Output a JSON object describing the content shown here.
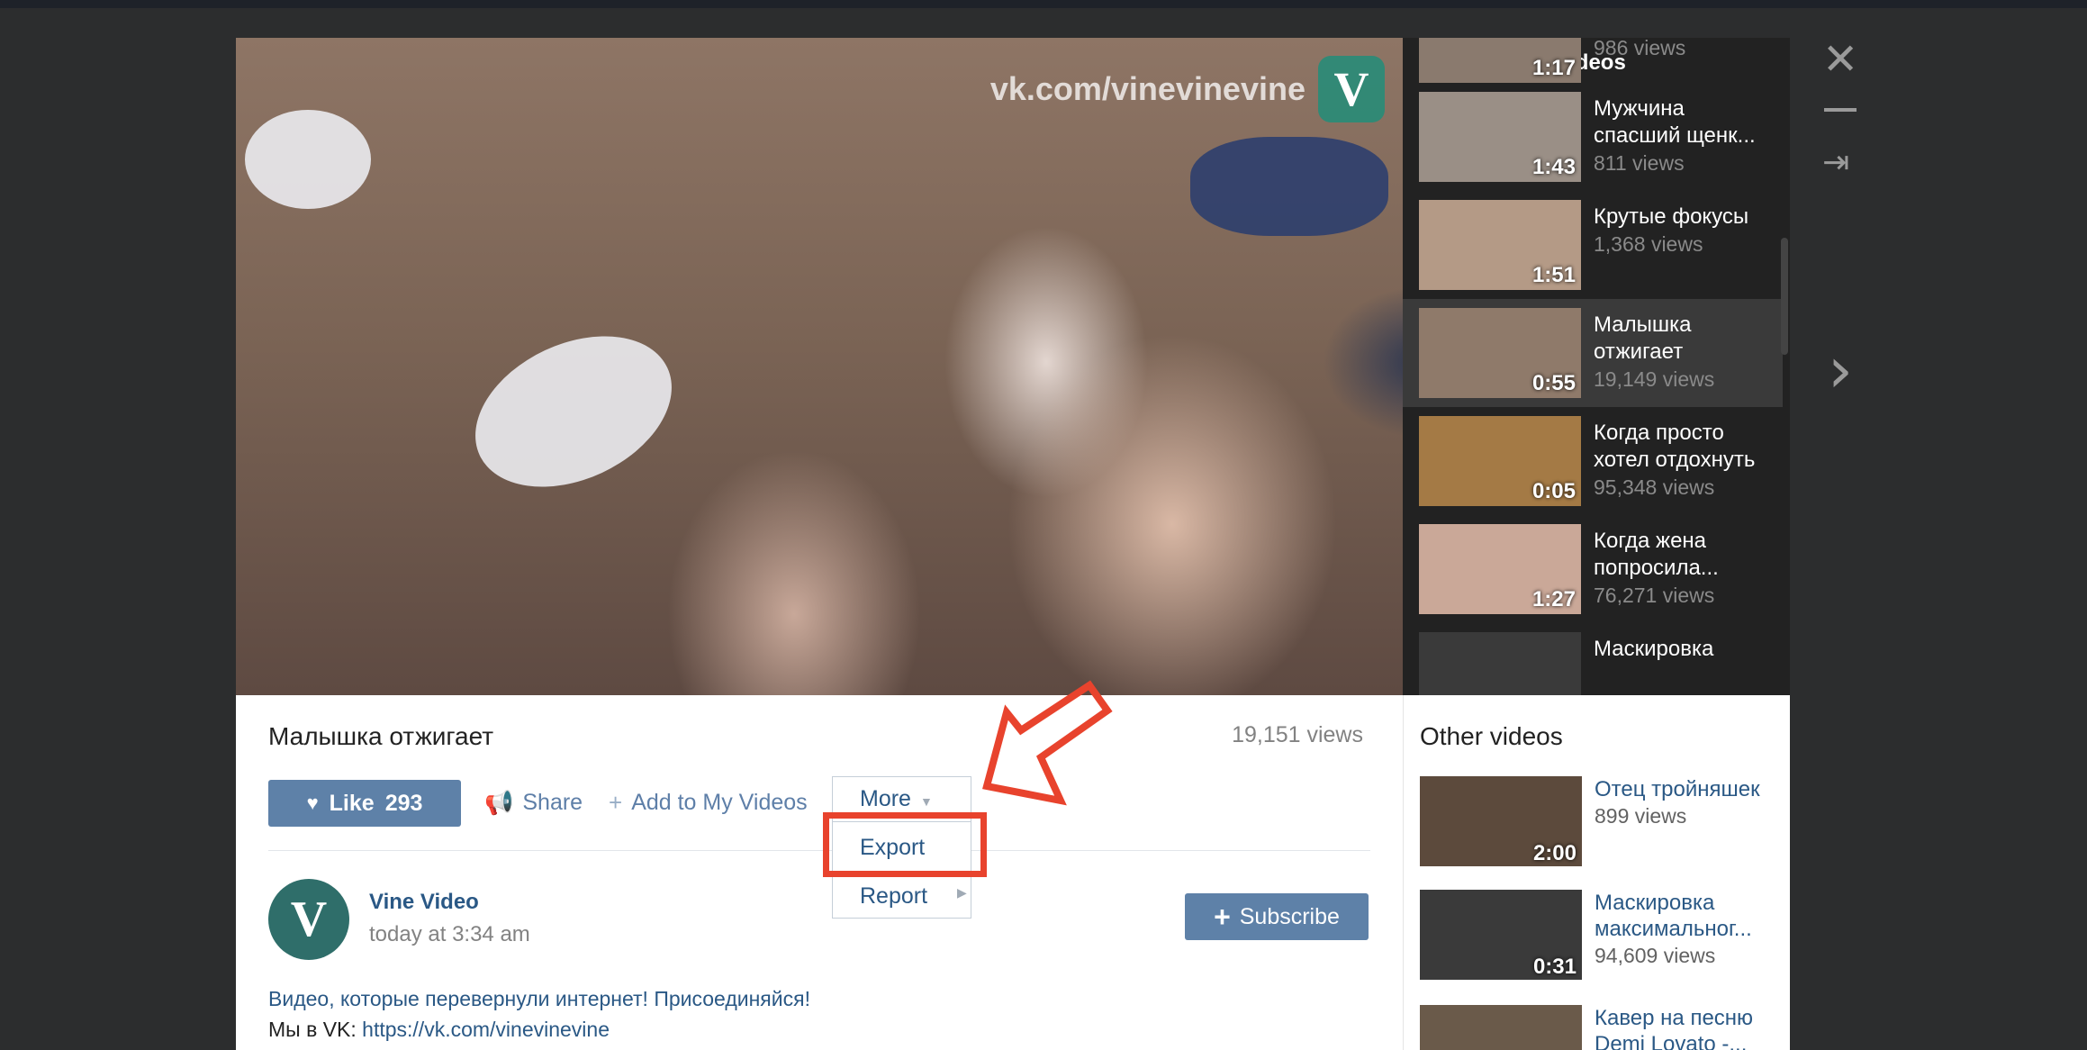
{
  "player": {
    "watermark": "vk.com/vinevinevine",
    "logo_letter": "V"
  },
  "playlist": {
    "title": "Vine Video's Videos",
    "items": [
      {
        "name": "",
        "views": "986 views",
        "duration": "1:17",
        "thumb_color": "#8a7a6e"
      },
      {
        "name": "Мужчина спасший щенк...",
        "views": "811 views",
        "duration": "1:43",
        "thumb_color": "#9a8f86"
      },
      {
        "name": "Крутые фокусы",
        "views": "1,368 views",
        "duration": "1:51",
        "thumb_color": "#b49a86"
      },
      {
        "name": "Малышка отжигает",
        "views": "19,149 views",
        "duration": "0:55",
        "thumb_color": "#8f7a6a",
        "active": true
      },
      {
        "name": "Когда просто хотел отдохнуть",
        "views": "95,348 views",
        "duration": "0:05",
        "thumb_color": "#a47a45"
      },
      {
        "name": "Когда жена попросила...",
        "views": "76,271 views",
        "duration": "1:27",
        "thumb_color": "#caa898"
      },
      {
        "name": "Маскировка",
        "views": "",
        "duration": "",
        "thumb_color": "#3a3a3a"
      }
    ]
  },
  "video": {
    "title": "Малышка отжигает",
    "views": "19,151 views",
    "like_label": "Like",
    "like_count": "293",
    "share_label": "Share",
    "add_label": "Add to My Videos",
    "more_label": "More"
  },
  "menu": {
    "export_label": "Export",
    "report_label": "Report"
  },
  "channel": {
    "name": "Vine Video",
    "time": "today at 3:34 am",
    "subscribe_label": "Subscribe",
    "avatar_letter": "V"
  },
  "description": {
    "line1": "Видео, которые перевернули интернет! Присоединяйся!",
    "line2_prefix": "Мы в VK: ",
    "line2_link": "https://vk.com/vinevinevine"
  },
  "other": {
    "title": "Other videos",
    "items": [
      {
        "name": "Отец тройняшек",
        "views": "899 views",
        "duration": "2:00",
        "thumb_color": "#5c4a3c"
      },
      {
        "name": "Маскировка максимальног...",
        "views": "94,609 views",
        "duration": "0:31",
        "thumb_color": "#3a3a3a"
      },
      {
        "name": "Кавер на песню Demi Lovato -...",
        "views": "",
        "duration": "",
        "thumb_color": "#6a5a4a"
      }
    ]
  },
  "colors": {
    "accent": "#5e81a8",
    "link": "#2a5885",
    "highlight": "#e8432d"
  }
}
